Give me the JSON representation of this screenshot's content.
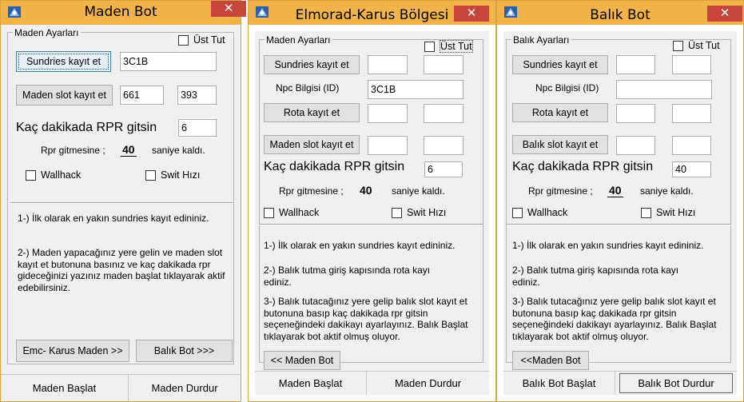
{
  "colors": {
    "titlebar": "#f1b34a",
    "close": "#c7453b",
    "client": "#f0f0f0"
  },
  "windows": [
    {
      "title": "Maden Bot",
      "close_glyph": "✕",
      "group_title": "Maden Ayarları",
      "ust_tut": "Üst Tut",
      "sundries_btn": "Sundries kayıt et",
      "sundries_value": "3C1B",
      "maden_slot_btn": "Maden slot kayıt et",
      "slot_x": "661",
      "slot_y": "393",
      "rpr_label": "Kaç dakikada RPR gitsin",
      "rpr_value": "6",
      "rpr_left": "Rpr gitmesine ;",
      "rpr_seconds": "40",
      "rpr_right": "saniye kaldı.",
      "wallhack": "Wallhack",
      "swit": "Swit Hızı",
      "info1": "1-) İlk olarak en yakın sundries kayıt edininiz.",
      "info2": "2-) Maden yapacağınız yere gelin ve maden slot kayıt et butonuna basınız ve kaç dakikada rpr gideceğinizi yazınız maden başlat tıklayarak aktif edebilirsiniz.",
      "nav_left": "Emc- Karus Maden >>",
      "nav_right": "Balık Bot >>>",
      "status_start": "Maden Başlat",
      "status_stop": "Maden Durdur"
    },
    {
      "title": "Elmorad-Karus Bölgesi",
      "close_glyph": "✕",
      "group_title": "Maden Ayarları",
      "ust_tut": "Üst Tut",
      "sundries_btn": "Sundries kayıt et",
      "npc_label": "Npc Bilgisi (ID)",
      "npc_value": "3C1B",
      "rota_btn": "Rota kayıt et",
      "maden_slot_btn": "Maden slot kayıt et",
      "rpr_label": "Kaç dakikada RPR gitsin",
      "rpr_value": "6",
      "rpr_left": "Rpr gitmesine ;",
      "rpr_seconds": "40",
      "rpr_right": "saniye kaldı.",
      "wallhack": "Wallhack",
      "swit": "Swit Hızı",
      "info1": "1-) İlk olarak en yakın sundries kayıt edininiz.",
      "info2": "2-) Balık tutma giriş kapısında rota kayı ediniz.",
      "info3": "3-) Balık tutacağınız yere gelip balık slot kayıt et butonuna basıp kaç dakikada rpr gitsin seçeneğindeki dakikayı ayarlayınız. Balık Başlat tıklayarak bot aktif olmuş oluyor.",
      "nav_left": "<< Maden Bot",
      "status_start": "Maden Başlat",
      "status_stop": "Maden Durdur"
    },
    {
      "title": "Balık Bot",
      "close_glyph": "✕",
      "group_title": "Balık Ayarları",
      "ust_tut": "Üst Tut",
      "sundries_btn": "Sundries kayıt et",
      "npc_label": "Npc Bilgisi (ID)",
      "npc_value": "",
      "rota_btn": "Rota kayıt et",
      "balik_slot_btn": "Balık slot kayıt et",
      "rpr_label": "Kaç dakikada RPR gitsin",
      "rpr_value": "40",
      "rpr_left": "Rpr gitmesine ;",
      "rpr_seconds": "40",
      "rpr_right": "saniye kaldı.",
      "wallhack": "Wallhack",
      "swit": "Swit Hızı",
      "info1": "1-) İlk olarak en yakın sundries kayıt edininiz.",
      "info2": "2-) Balık tutma giriş kapısında rota kayı ediniz.",
      "info3": "3-) Balık tutacağınız yere gelip balık slot kayıt et butonuna basıp kaç dakikada rpr gitsin seçeneğindeki dakikayı ayarlayınız. Balık Başlat tıklayarak bot aktif olmuş oluyor.",
      "nav_left": "<<Maden Bot",
      "status_start": "Balık Bot Başlat",
      "status_stop": "Balık Bot Durdur"
    }
  ]
}
